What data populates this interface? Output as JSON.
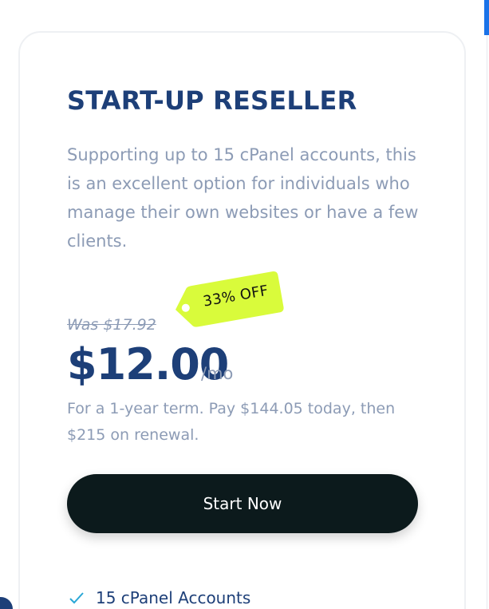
{
  "plan": {
    "title": "START-UP RESELLER",
    "description": "Supporting up to 15 cPanel accounts, this is an excellent option for individuals who manage their own websites or have a few clients.",
    "was_price": "Was $17.92",
    "discount_tag": "33% OFF",
    "price": "$12.00",
    "price_unit": "/mo",
    "term_note": "For a 1-year term. Pay $144.05 today, then $215 on renewal.",
    "cta_label": "Start Now",
    "features": [
      {
        "label": "15 cPanel Accounts",
        "icon": "check-icon"
      }
    ]
  },
  "colors": {
    "title": "#1d3f78",
    "muted": "#8c9bb5",
    "tag": "#d9fb3b",
    "button": "#0c1a1c",
    "check": "#2aa7d6"
  }
}
